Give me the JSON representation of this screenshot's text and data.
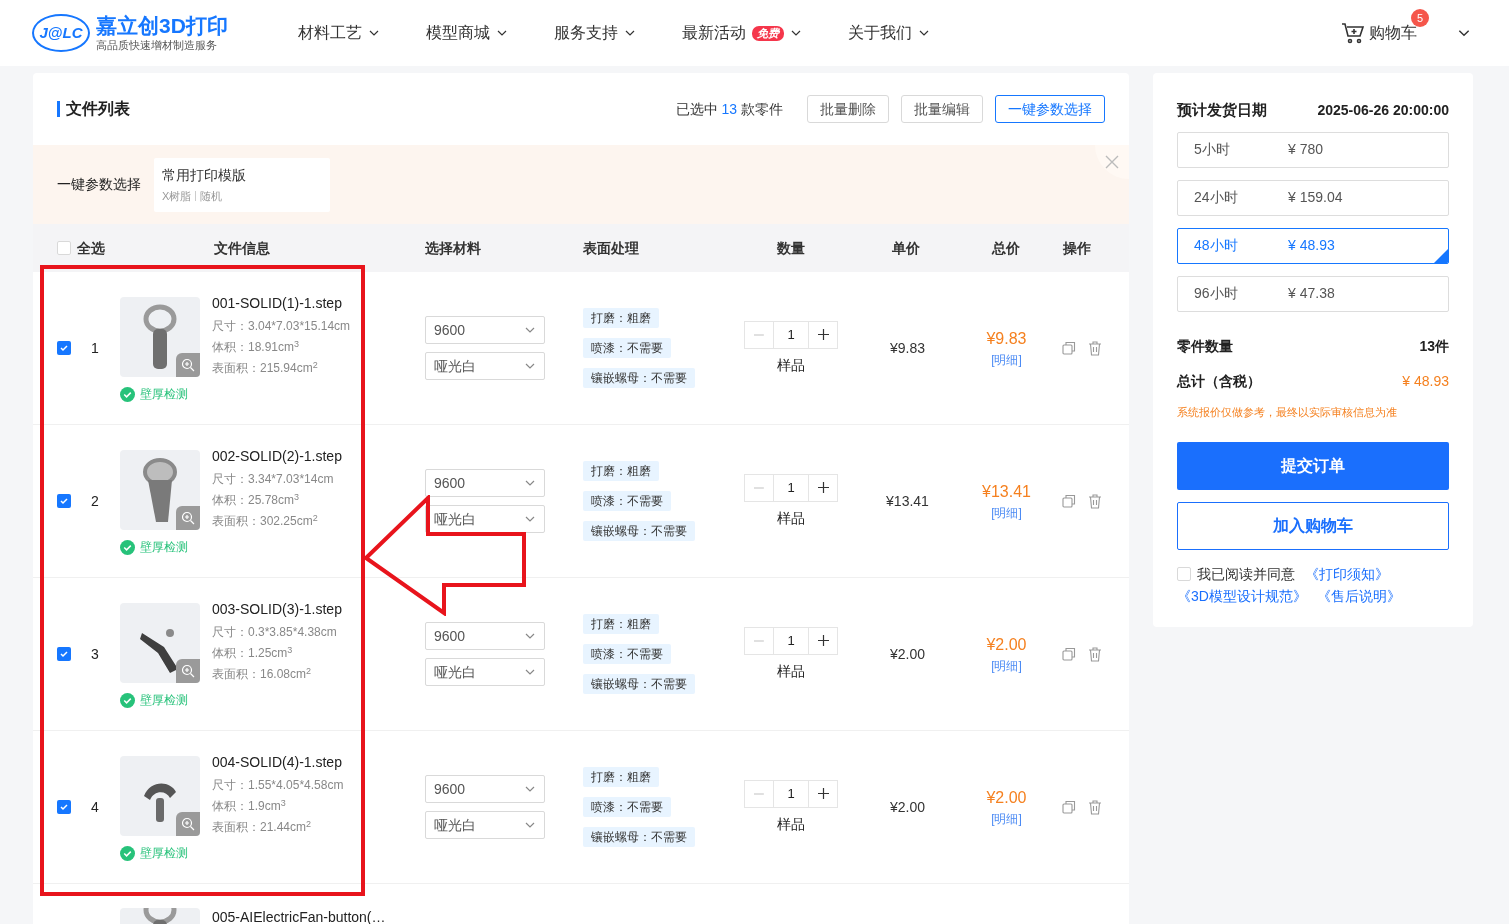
{
  "header": {
    "logo_mark": "J@LC",
    "brand": "嘉立创3D打印",
    "tagline": "高品质快速增材制造服务",
    "nav": [
      {
        "label": "材料工艺"
      },
      {
        "label": "模型商城"
      },
      {
        "label": "服务支持"
      },
      {
        "label": "最新活动",
        "badge": "免费"
      },
      {
        "label": "关于我们"
      }
    ],
    "cart": {
      "label": "购物车",
      "count": "5"
    }
  },
  "file_list": {
    "title": "文件列表",
    "selection": {
      "prefix": "已选中",
      "count": "13",
      "suffix": "款零件"
    },
    "buttons": [
      {
        "label": "批量删除",
        "kind": "default"
      },
      {
        "label": "批量编辑",
        "kind": "default"
      },
      {
        "label": "一键参数选择",
        "kind": "primary"
      }
    ]
  },
  "preset_bar": {
    "label": "一键参数选择",
    "preset": {
      "title": "常用打印模版",
      "material": "X树脂",
      "option": "随机"
    }
  },
  "table": {
    "select_all": {
      "label": "全选",
      "checked": false
    },
    "columns": [
      "文件信息",
      "选择材料",
      "表面处理",
      "数量",
      "单价",
      "总价",
      "操作"
    ],
    "rows": [
      {
        "kind": "full",
        "checked": true,
        "index": "1",
        "name": "001-SOLID(1)-1.step",
        "size": "尺寸：3.04*7.03*15.14cm",
        "volume": "体积：18.91cm$^{3}$",
        "area": "表面积：215.94cm$^{2}$",
        "check": "壁厚检测",
        "material": "9600",
        "finish_color": "哑光白",
        "finishes": [
          "打磨：粗磨",
          "喷漆：不需要",
          "镶嵌螺母：不需要"
        ],
        "quantity": "1",
        "quantity_note": "样品",
        "unit_price": "¥9.83",
        "total": "¥9.83",
        "detail_link": "[明细]"
      },
      {
        "kind": "full",
        "checked": true,
        "index": "2",
        "name": "002-SOLID(2)-1.step",
        "size": "尺寸：3.34*7.03*14cm",
        "volume": "体积：25.78cm$^{3}$",
        "area": "表面积：302.25cm$^{2}$",
        "check": "壁厚检测",
        "material": "9600",
        "finish_color": "哑光白",
        "finishes": [
          "打磨：粗磨",
          "喷漆：不需要",
          "镶嵌螺母：不需要"
        ],
        "quantity": "1",
        "quantity_note": "样品",
        "unit_price": "¥13.41",
        "total": "¥13.41",
        "detail_link": "[明细]"
      },
      {
        "kind": "full",
        "checked": true,
        "index": "3",
        "name": "003-SOLID(3)-1.step",
        "size": "尺寸：0.3*3.85*4.38cm",
        "volume": "体积：1.25cm$^{3}$",
        "area": "表面积：16.08cm$^{2}$",
        "check": "壁厚检测",
        "material": "9600",
        "finish_color": "哑光白",
        "finishes": [
          "打磨：粗磨",
          "喷漆：不需要",
          "镶嵌螺母：不需要"
        ],
        "quantity": "1",
        "quantity_note": "样品",
        "unit_price": "¥2.00",
        "total": "¥2.00",
        "detail_link": "[明细]"
      },
      {
        "kind": "full",
        "checked": true,
        "index": "4",
        "name": "004-SOLID(4)-1.step",
        "size": "尺寸：1.55*4.05*4.58cm",
        "volume": "体积：1.9cm$^{3}$",
        "area": "表面积：21.44cm$^{2}$",
        "check": "壁厚检测",
        "material": "9600",
        "finish_color": "哑光白",
        "finishes": [
          "打磨：粗磨",
          "喷漆：不需要",
          "镶嵌螺母：不需要"
        ],
        "quantity": "1",
        "quantity_note": "样品",
        "unit_price": "¥2.00",
        "total": "¥2.00",
        "detail_link": "[明细]"
      },
      {
        "kind": "partial",
        "name": "005-AIElectricFan-button(…"
      }
    ]
  },
  "order_summary": {
    "ship_date_label": "预计发货日期",
    "ship_date": "2025-06-26 20:00:00",
    "options": [
      {
        "time": "5小时",
        "price": "¥ 780",
        "selected": false
      },
      {
        "time": "24小时",
        "price": "¥ 159.04",
        "selected": false
      },
      {
        "time": "48小时",
        "price": "¥ 48.93",
        "selected": true
      },
      {
        "time": "96小时",
        "price": "¥ 47.38",
        "selected": false
      }
    ],
    "parts_label": "零件数量",
    "parts_value": "13件",
    "total_label": "总计（含税）",
    "total_value": "¥ 48.93",
    "notice": "系统报价仅做参考，最终以实际审核信息为准",
    "submit": "提交订单",
    "add_to_cart": "加入购物车",
    "agreement": {
      "checked": false,
      "text": "我已阅读并同意",
      "links": [
        "《打印须知》",
        "《3D模型设计规范》",
        "《售后说明》"
      ]
    }
  }
}
